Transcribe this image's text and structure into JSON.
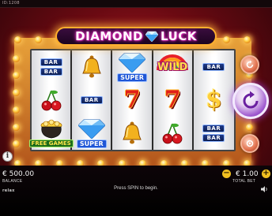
{
  "top": {
    "game_id": "ID:1208"
  },
  "logo": {
    "left_word": "DIAMOND",
    "right_word": "LUCK"
  },
  "reels": [
    [
      {
        "symbol": "bar-double",
        "label": "BAR"
      },
      {
        "symbol": "cherry",
        "label": ""
      },
      {
        "symbol": "free-games",
        "label": "FREE GAMES"
      }
    ],
    [
      {
        "symbol": "bell",
        "label": ""
      },
      {
        "symbol": "bar-single",
        "label": "BAR"
      },
      {
        "symbol": "super-diamond",
        "label": "SUPER"
      }
    ],
    [
      {
        "symbol": "super-diamond",
        "label": "SUPER"
      },
      {
        "symbol": "seven",
        "label": "7"
      },
      {
        "symbol": "bell",
        "label": ""
      }
    ],
    [
      {
        "symbol": "wild-rainbow",
        "label": "WILD"
      },
      {
        "symbol": "seven",
        "label": "7"
      },
      {
        "symbol": "cherry",
        "label": ""
      }
    ],
    [
      {
        "symbol": "bar-single",
        "label": "BAR"
      },
      {
        "symbol": "dollar",
        "label": "$"
      },
      {
        "symbol": "bar-double",
        "label": "BAR"
      }
    ]
  ],
  "bottom": {
    "balance_value": "€ 500.00",
    "balance_label": "BALANCE",
    "bet_value": "€ 1.00",
    "bet_label": "TOTAL BET",
    "bet_minus": "−",
    "bet_plus": "+",
    "status_text": "Press SPIN to begin.",
    "brand": "relax"
  },
  "buttons": {
    "autoplay_icon": "refresh-icon",
    "spin_icon": "spin-arrow-icon",
    "turbo_icon": "gear-icon",
    "info_icon": "info-icon",
    "info_label": "i"
  },
  "colors": {
    "accent": "#a05ad0",
    "marquee": "#ffd24a",
    "background": "#6a0a12"
  }
}
